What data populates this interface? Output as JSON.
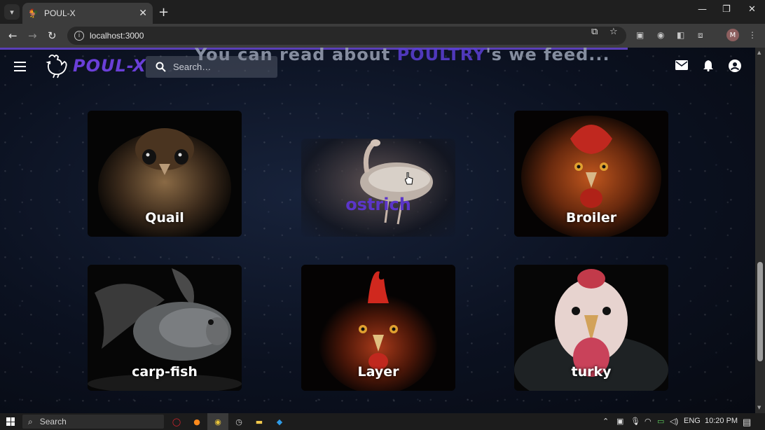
{
  "browser": {
    "tab_title": "POUL-X",
    "url": "localhost:3000",
    "profile_initial": "M"
  },
  "header": {
    "logo_text": "POUL-X",
    "search_placeholder": "Search…",
    "bg_heading_pre": "You can read about ",
    "bg_heading_hl": "POULTRY",
    "bg_heading_post": "'s we feed..."
  },
  "cards": [
    {
      "label": "Quail"
    },
    {
      "label": "ostrich"
    },
    {
      "label": "Broiler"
    },
    {
      "label": "carp-fish"
    },
    {
      "label": "Layer"
    },
    {
      "label": "turky"
    }
  ],
  "taskbar": {
    "search_label": "Search",
    "lang": "ENG",
    "time": "10:20 PM"
  },
  "colors": {
    "accent": "#5b3fd6",
    "page_bg": "#0b1120"
  }
}
